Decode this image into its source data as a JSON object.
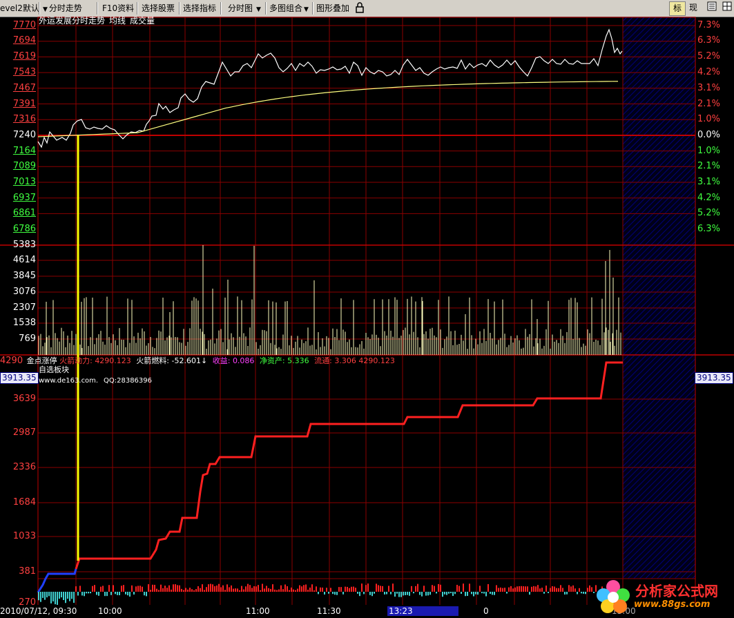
{
  "toolbar": {
    "items": [
      "evel2默认",
      "分时走势",
      "F10资料",
      "选择股票",
      "选择指标",
      "分时图",
      "多图组合",
      "图形叠加"
    ],
    "lock_icon": "lock-icon",
    "right_items": [
      "标",
      "现"
    ]
  },
  "main_panel": {
    "title": "外运发展分时走势",
    "avg_label": "均线",
    "volume_label": "成交量",
    "price_labels_up": [
      "7770",
      "7694",
      "7619",
      "7543",
      "7467",
      "7391",
      "7316"
    ],
    "price_label_base": "7240",
    "price_labels_down": [
      "7164",
      "7089",
      "7013",
      "6937",
      "6861",
      "6786"
    ],
    "pct_labels_up": [
      "7.3%",
      "6.3%",
      "5.2%",
      "4.2%",
      "3.1%",
      "2.1%",
      "1.0%"
    ],
    "pct_label_base": "0.0%",
    "pct_labels_down": [
      "1.0%",
      "2.1%",
      "3.1%",
      "4.2%",
      "5.2%",
      "6.3%"
    ]
  },
  "volume_panel": {
    "labels": [
      "5383",
      "4614",
      "3845",
      "3076",
      "2307",
      "1538",
      "769"
    ]
  },
  "indicator_panel": {
    "top_label": "4290",
    "name": "金点涨停",
    "block": "自选板块",
    "site": "www.de163.com.",
    "qq": "QQ:28386396",
    "rocket_power_label": "火箭动力:",
    "rocket_power_value": "4290.123",
    "rocket_fuel_label": "火箭燃料:",
    "rocket_fuel_value": "-52.601↓",
    "earnings_label": "收益:",
    "earnings_value": "0.086",
    "net_asset_label": "净资产:",
    "net_asset_value": "5.336",
    "float_label": "流通:",
    "float_value": "3.306",
    "tail_value": "4290.123",
    "left_box": "3913.35",
    "right_box": "3913.35",
    "axis_labels": [
      "3639",
      "2987",
      "2336",
      "1684",
      "1033",
      "381"
    ],
    "bottom_partial": "270"
  },
  "time_axis": {
    "date_time": "2010/07/12, 09:30",
    "labels": [
      "10:00",
      "11:00",
      "11:30",
      "0"
    ],
    "cursor": "13:23",
    "end_label": "15:00"
  },
  "watermark": {
    "title": "分析家公式网",
    "url": "www.88gs.com"
  },
  "colors": {
    "grid": "#8b0000",
    "price_line": "#ffffff",
    "avg_line": "#ffff80",
    "indicator_line": "#ff2020",
    "indicator_start": "#2040ff",
    "marker": "#ffff00",
    "hatch": "#000080"
  }
}
